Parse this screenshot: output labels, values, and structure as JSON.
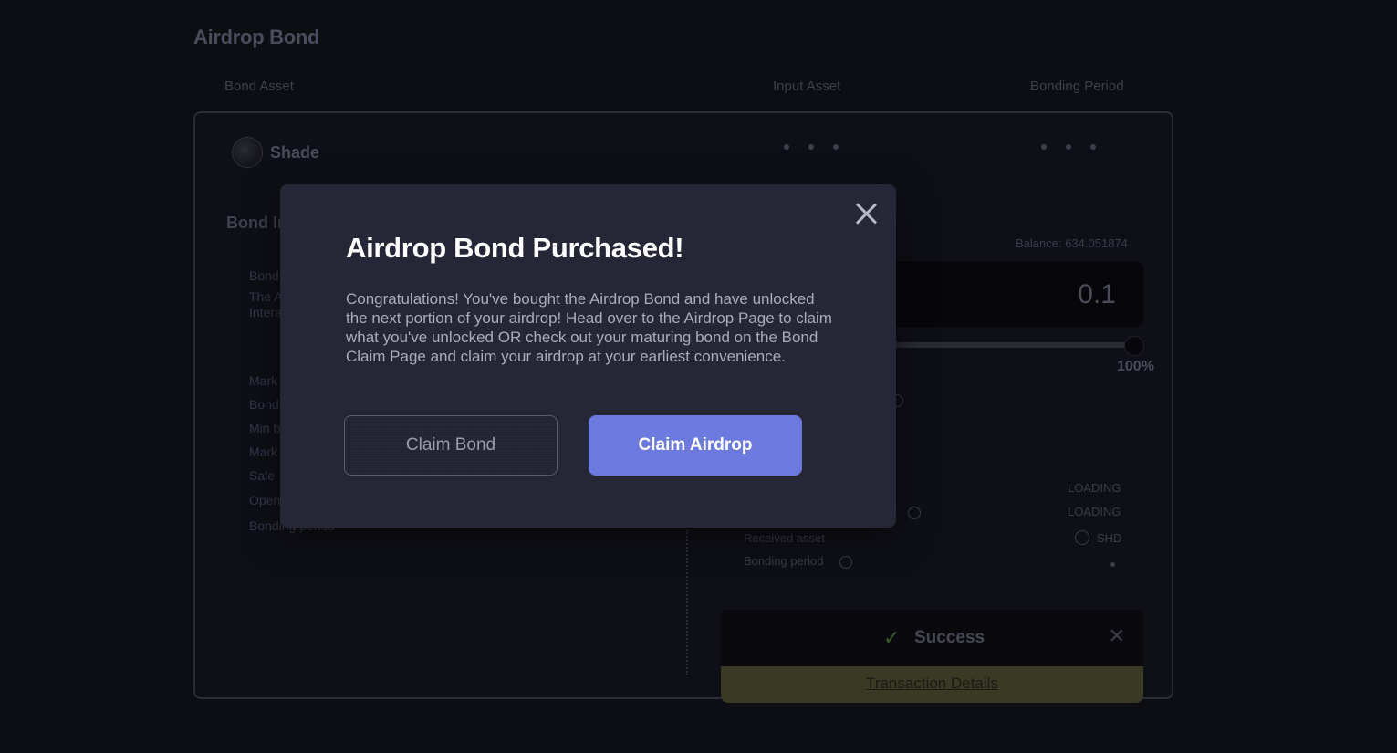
{
  "page": {
    "title": "Airdrop Bond",
    "columns": [
      "Bond Asset",
      "Input Asset",
      "Bonding Period"
    ]
  },
  "bond_card": {
    "asset_name": "Shade",
    "bond_info_title": "Bond In",
    "bond_desc_label": "Bond",
    "bond_desc_lines": [
      "The A",
      "Intera"
    ],
    "info_labels": [
      "Mark",
      "Bond",
      "Min b",
      "Mark",
      "Sale",
      "Open",
      "Bonding period"
    ]
  },
  "purchase_panel": {
    "balance": "Balance: 634.051874",
    "amount": "0.1",
    "slider_percent": "100%",
    "slider_value": 1.0,
    "rows": [
      {
        "value": "LOADING"
      },
      {
        "value": "LOADING"
      },
      {
        "label": "Received asset",
        "value": "SHD"
      },
      {
        "label": "Bonding period"
      }
    ]
  },
  "toast": {
    "message": "Success",
    "link": "Transaction Details",
    "check_icon": "check-icon",
    "close_icon": "close-icon",
    "accent": "#3b5a2e"
  },
  "modal": {
    "title": "Airdrop Bond Purchased!",
    "body": "Congratulations! You've bought the Airdrop Bond and have unlocked the next portion of your airdrop! Head over to the Airdrop Page to claim what you've unlocked OR check out your maturing bond on the Bond Claim Page and claim your airdrop at your earliest convenience.",
    "secondary_button": "Claim Bond",
    "primary_button": "Claim Airdrop",
    "close_icon": "close-icon",
    "primary_color": "#6c7ae0"
  }
}
